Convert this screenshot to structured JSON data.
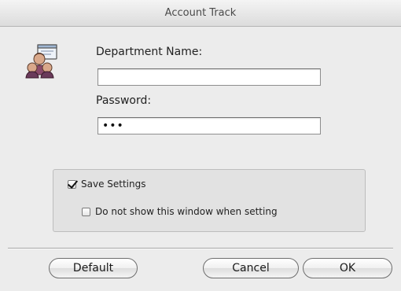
{
  "window": {
    "title": "Account Track"
  },
  "icon": {
    "name": "department-users-icon"
  },
  "form": {
    "department_label": "Department Name:",
    "department_value": "",
    "password_label": "Password:",
    "password_value": "•••"
  },
  "options": {
    "save_settings": {
      "label": "Save Settings",
      "checked": true
    },
    "do_not_show": {
      "label": "Do not show this window when setting",
      "checked": false
    }
  },
  "buttons": {
    "default_label": "Default",
    "cancel_label": "Cancel",
    "ok_label": "OK"
  }
}
